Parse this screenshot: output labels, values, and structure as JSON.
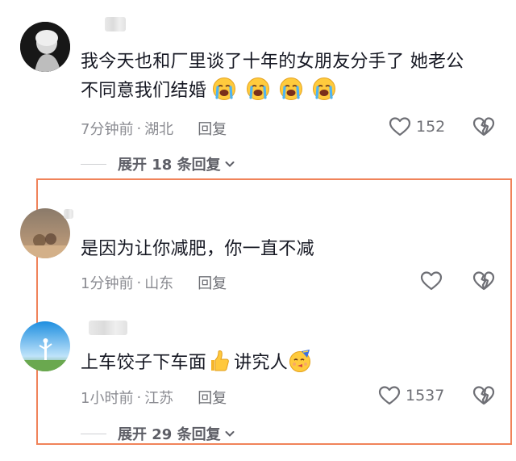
{
  "comments": [
    {
      "text_line1": "我今天也和厂里谈了十年的女朋友分手了 她老公",
      "text_line2": "不同意我们结婚",
      "time": "7分钟前",
      "location": "湖北",
      "reply_label": "回复",
      "likes": "152",
      "expand_label": "展开 18 条回复"
    },
    {
      "text": "是因为让你减肥，你一直不减",
      "time": "1分钟前",
      "location": "山东",
      "reply_label": "回复"
    },
    {
      "text_a": "上车饺子下车面",
      "text_b": "讲究人",
      "time": "1小时前",
      "location": "江苏",
      "reply_label": "回复",
      "likes": "1537",
      "expand_label": "展开 29 条回复"
    }
  ],
  "separator": "·",
  "colors": {
    "highlight_border": "#f0835a",
    "meta_gray": "#8a8b91",
    "text": "#161823"
  },
  "icons": [
    "heart-outline-icon",
    "broken-heart-icon",
    "chevron-down-icon",
    "crying-face-emoji",
    "thumbs-up-emoji",
    "party-face-emoji"
  ]
}
